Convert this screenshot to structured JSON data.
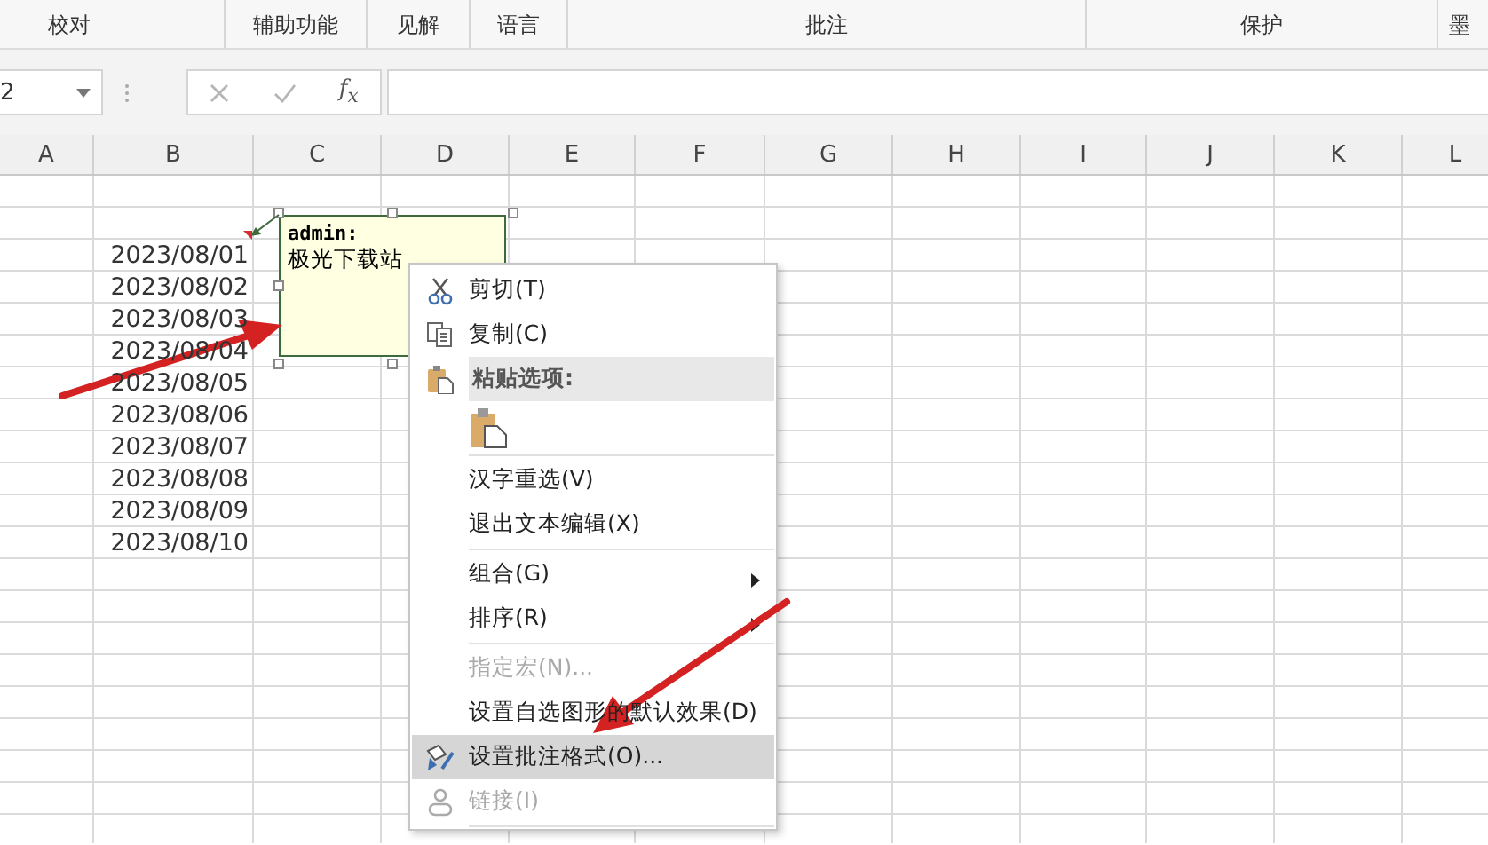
{
  "ribbon": {
    "groups": [
      "校对",
      "辅助功能",
      "见解",
      "语言",
      "批注",
      "保护",
      "墨"
    ]
  },
  "formula_bar": {
    "name_box": "2",
    "function_label": "f$_{x}$"
  },
  "columns": [
    "A",
    "B",
    "C",
    "D",
    "E",
    "F",
    "G",
    "H",
    "I",
    "J",
    "K",
    "L"
  ],
  "dates": [
    "2023/08/01",
    "2023/08/02",
    "2023/08/03",
    "2023/08/04",
    "2023/08/05",
    "2023/08/06",
    "2023/08/07",
    "2023/08/08",
    "2023/08/09",
    "2023/08/10"
  ],
  "comment": {
    "author": "admin:",
    "text": "极光下载站"
  },
  "context_menu": {
    "items": [
      {
        "kind": "item",
        "label": "剪切(T)",
        "disabled": false,
        "selected": false,
        "submenu": false
      },
      {
        "kind": "item",
        "label": "复制(C)",
        "disabled": false,
        "selected": false,
        "submenu": false
      },
      {
        "kind": "header",
        "label": "粘贴选项:"
      },
      {
        "kind": "paste-option"
      },
      {
        "kind": "separator"
      },
      {
        "kind": "item",
        "label": "汉字重选(V)",
        "disabled": false,
        "selected": false,
        "submenu": false
      },
      {
        "kind": "item",
        "label": "退出文本编辑(X)",
        "disabled": false,
        "selected": false,
        "submenu": false
      },
      {
        "kind": "separator"
      },
      {
        "kind": "item",
        "label": "组合(G)",
        "disabled": false,
        "selected": false,
        "submenu": true
      },
      {
        "kind": "item",
        "label": "排序(R)",
        "disabled": false,
        "selected": false,
        "submenu": true
      },
      {
        "kind": "separator"
      },
      {
        "kind": "item",
        "label": "指定宏(N)...",
        "disabled": true,
        "selected": false,
        "submenu": false
      },
      {
        "kind": "item",
        "label": "设置自选图形的默认效果(D)",
        "disabled": false,
        "selected": false,
        "submenu": false
      },
      {
        "kind": "item",
        "label": "设置批注格式(O)...",
        "disabled": false,
        "selected": true,
        "submenu": false
      },
      {
        "kind": "item",
        "label": "链接(I)",
        "disabled": true,
        "selected": false,
        "submenu": false
      },
      {
        "kind": "separator"
      }
    ]
  }
}
